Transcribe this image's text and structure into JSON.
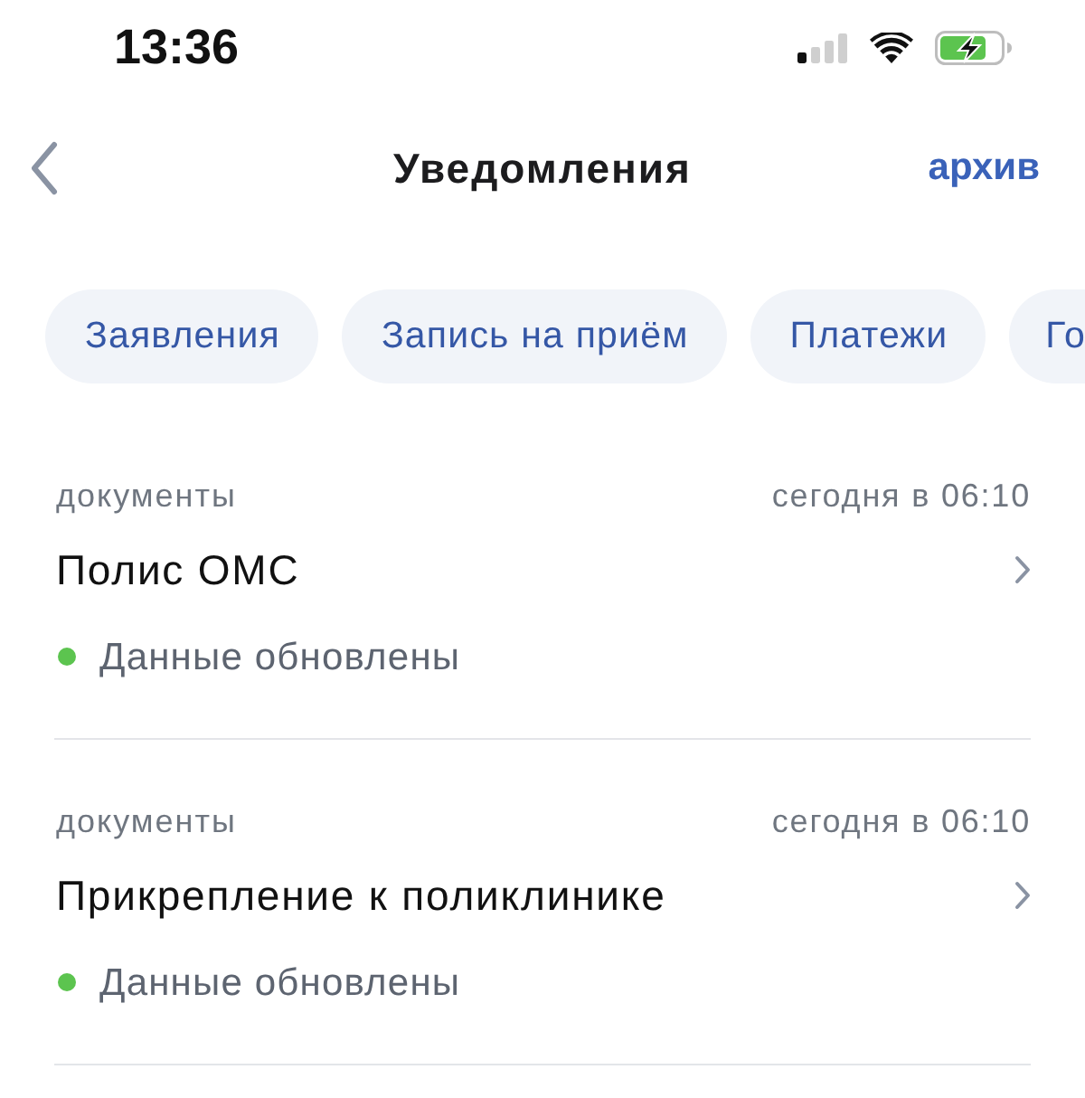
{
  "status_bar": {
    "time": "13:36"
  },
  "nav": {
    "title": "Уведомления",
    "action": "архив"
  },
  "filters": [
    {
      "label": "Заявления",
      "selected": false
    },
    {
      "label": "Запись на приём",
      "selected": false
    },
    {
      "label": "Платежи",
      "selected": false
    },
    {
      "label": "Го",
      "selected": false
    }
  ],
  "notifications": [
    {
      "category": "документы",
      "time": "сегодня в 06:10",
      "title": "Полис ОМС",
      "status": {
        "text": "Данные обновлены",
        "color": "#5cc44f"
      }
    },
    {
      "category": "документы",
      "time": "сегодня в 06:10",
      "title": "Прикрепление к поликлинике",
      "status": {
        "text": "Данные обновлены",
        "color": "#5cc44f"
      }
    }
  ]
}
